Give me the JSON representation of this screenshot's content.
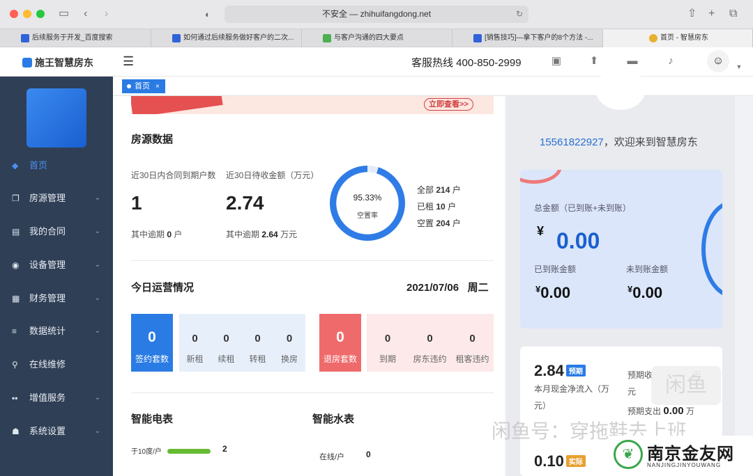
{
  "browser": {
    "url": "不安全 — zhihuifangdong.net",
    "tabs": [
      {
        "label": "后续服务于开发_百度搜索"
      },
      {
        "label": "如何通过后续服务做好客户的二次..."
      },
      {
        "label": "与客户沟通的四大要点"
      },
      {
        "label": "[销售技巧]—拿下客户的8个方法 -..."
      },
      {
        "label": "首页 - 智慧房东"
      }
    ]
  },
  "header": {
    "logo": "施王智慧房东",
    "hotline": "客服热线 400-850-2999"
  },
  "sidebar": {
    "items": [
      {
        "label": "首页",
        "icon": "home-icon"
      },
      {
        "label": "房源管理",
        "icon": "copy-icon"
      },
      {
        "label": "我的合同",
        "icon": "file-icon"
      },
      {
        "label": "设备管理",
        "icon": "gauge-icon"
      },
      {
        "label": "财务管理",
        "icon": "ledger-icon"
      },
      {
        "label": "数据统计",
        "icon": "list-icon"
      },
      {
        "label": "在线维修",
        "icon": "search-icon"
      },
      {
        "label": "增值服务",
        "icon": "grid-icon"
      },
      {
        "label": "系统设置",
        "icon": "users-icon"
      }
    ]
  },
  "breadcrumb": {
    "label": "首页",
    "close": "×"
  },
  "banner": {
    "button": "立即查看>>"
  },
  "housing": {
    "title": "房源数据",
    "expire_label": "近30日内合同到期户数",
    "expire_value": "1",
    "expire_overdue_prefix": "其中逾期",
    "expire_overdue_value": "0",
    "expire_overdue_unit": "户",
    "due_label": "近30日待收金额（万元）",
    "due_value": "2.74",
    "due_overdue_prefix": "其中逾期",
    "due_overdue_value": "2.64",
    "due_overdue_unit": "万元",
    "vacancy_percent": "95.33%",
    "vacancy_label": "空置率",
    "vacancy_fraction": 0.9533,
    "stats": [
      {
        "label": "全部",
        "value": "214",
        "unit": "户"
      },
      {
        "label": "已租",
        "value": "10",
        "unit": "户"
      },
      {
        "label": "空置",
        "value": "204",
        "unit": "户"
      }
    ]
  },
  "ops": {
    "title": "今日运营情况",
    "date": "2021/07/06",
    "weekday": "周二",
    "sign": {
      "value": "0",
      "label": "签约套数"
    },
    "sign_cells": [
      {
        "value": "0",
        "label": "新租"
      },
      {
        "value": "0",
        "label": "续租"
      },
      {
        "value": "0",
        "label": "转租"
      },
      {
        "value": "0",
        "label": "换房"
      }
    ],
    "checkout": {
      "value": "0",
      "label": "退房套数"
    },
    "checkout_cells": [
      {
        "value": "0",
        "label": "到期"
      },
      {
        "value": "0",
        "label": "房东违约"
      },
      {
        "value": "0",
        "label": "租客违约"
      }
    ]
  },
  "meters": {
    "electric_title": "智能电表",
    "electric_row_label": "于10度/户",
    "electric_row_value": "2",
    "water_title": "智能水表",
    "water_row_label": "在线/户",
    "water_row_value": "0"
  },
  "account": {
    "phone": "15561822927",
    "welcome": "，欢迎来到智慧房东",
    "total_label": "总金额（已到账+未到账）",
    "currency": "¥",
    "total_value": "0.00",
    "received_label": "已到账金额",
    "received_value": "0.00",
    "pending_label": "未到账金额",
    "pending_value": "0.00"
  },
  "cashflow": {
    "net_value": "2.84",
    "net_tag": "预期",
    "net_label": "本月现金净流入（万",
    "net_label2": "元）",
    "income_label": "预期收",
    "income_suffix": "万",
    "income_label2": "元",
    "expense_label": "预期支出",
    "expense_value": "0.00",
    "expense_unit": "万",
    "actual_value": "0.10",
    "actual_tag": "实际"
  },
  "watermark": {
    "text": "闲鱼号：穿拖鞋去上班",
    "box": "闲鱼"
  },
  "site": {
    "name": "南京金友网",
    "sub": "NANJINGJINYOUWANG"
  },
  "colors": {
    "accent": "#2a7be4",
    "sidebar": "#2f3f56",
    "checkout": "#ef6b6b",
    "bar": "#66bb33"
  }
}
